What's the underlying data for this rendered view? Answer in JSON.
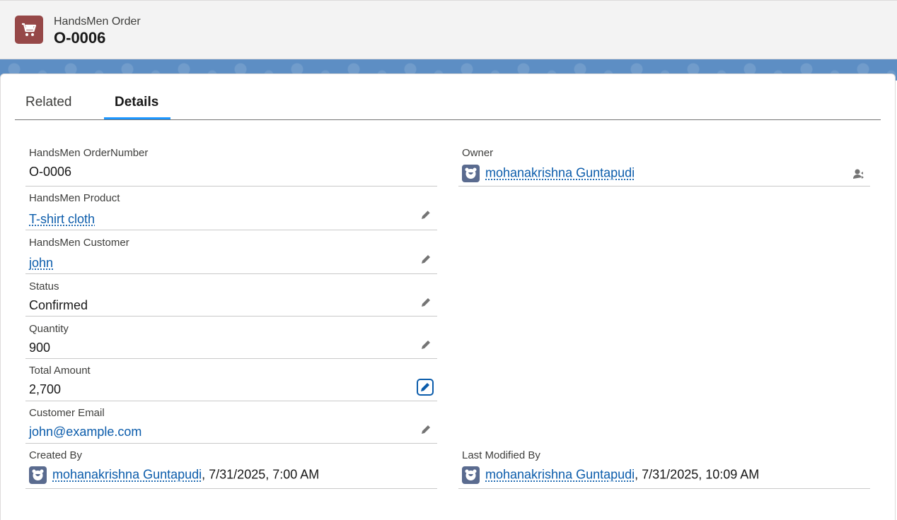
{
  "header": {
    "object_type": "HandsMen Order",
    "record_name": "O-0006",
    "icon": "cart-icon",
    "icon_color": "#964848"
  },
  "tabs": [
    {
      "label": "Related",
      "active": false
    },
    {
      "label": "Details",
      "active": true
    }
  ],
  "fields": {
    "order_number": {
      "label": "HandsMen OrderNumber",
      "value": "O-0006"
    },
    "product": {
      "label": "HandsMen Product",
      "value": "T-shirt cloth"
    },
    "customer": {
      "label": "HandsMen Customer",
      "value": "john"
    },
    "status": {
      "label": "Status",
      "value": "Confirmed"
    },
    "quantity": {
      "label": "Quantity",
      "value": "900"
    },
    "total_amount": {
      "label": "Total Amount",
      "value": "2,700"
    },
    "customer_email": {
      "label": "Customer Email",
      "value": "john@example.com"
    },
    "owner": {
      "label": "Owner",
      "value": "mohanakrishna Guntapudi"
    },
    "created_by": {
      "label": "Created By",
      "user": "mohanakrishna Guntapudi",
      "timestamp": ", 7/31/2025, 7:00 AM"
    },
    "last_modified_by": {
      "label": "Last Modified By",
      "user": "mohanakrishna Guntapudi",
      "timestamp": ", 7/31/2025, 10:09 AM"
    }
  },
  "colors": {
    "link": "#0b5cab",
    "active_tab": "#1b96ff",
    "banner": "#5d8ec4"
  }
}
